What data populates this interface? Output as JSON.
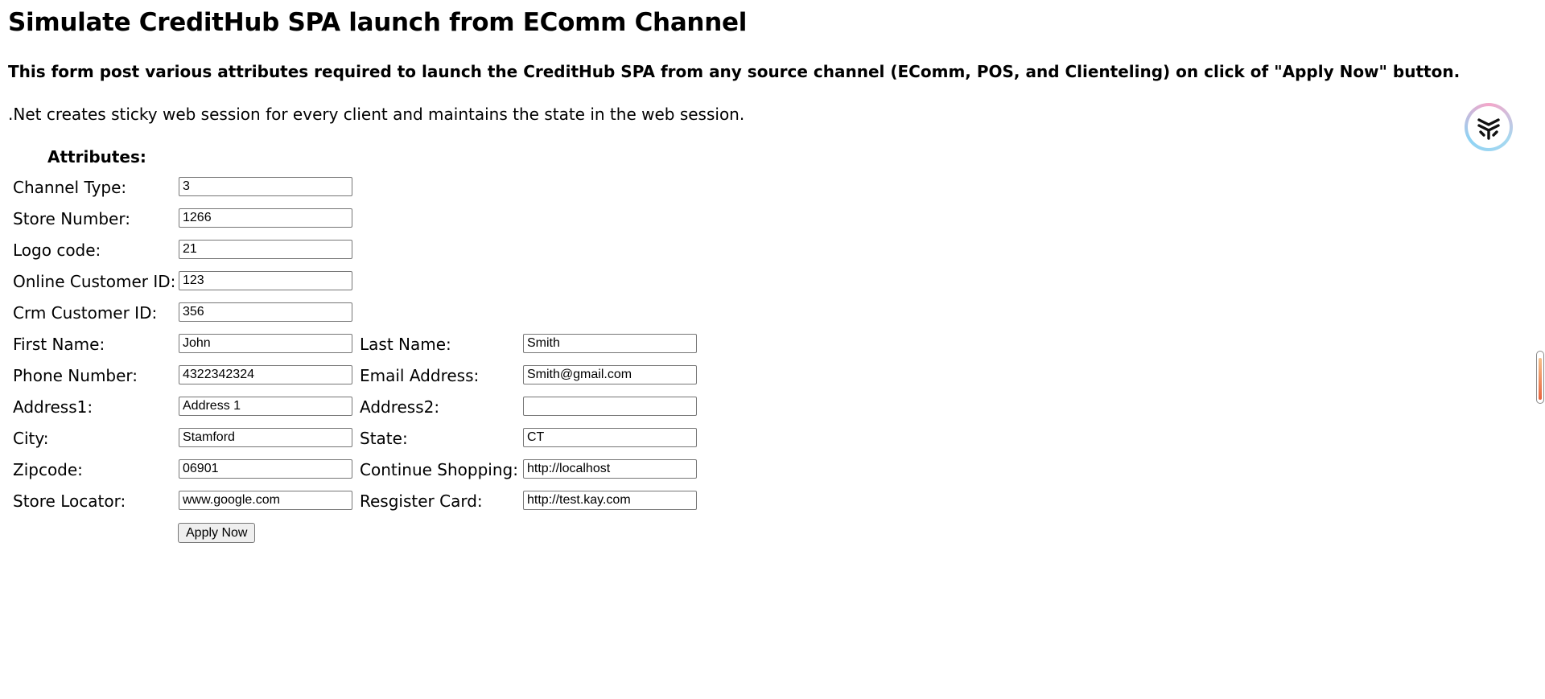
{
  "header": {
    "title": "Simulate CreditHub SPA launch from EComm Channel",
    "subtitle": "This form post various attributes required to launch the CreditHub SPA from any source channel (EComm, POS, and Clienteling) on click of \"Apply Now\" button.",
    "note": ".Net creates sticky web session for every client and maintains the state in the web session."
  },
  "form": {
    "heading": "Attributes:",
    "channel_type": {
      "label": "Channel Type:",
      "value": "3"
    },
    "store_number": {
      "label": "Store Number:",
      "value": "1266"
    },
    "logo_code": {
      "label": "Logo code:",
      "value": "21"
    },
    "online_customer_id": {
      "label": "Online Customer ID:",
      "value": "123"
    },
    "crm_customer_id": {
      "label": "Crm Customer ID:",
      "value": "356"
    },
    "first_name": {
      "label": "First Name:",
      "value": "John"
    },
    "last_name": {
      "label": "Last Name:",
      "value": "Smith"
    },
    "phone_number": {
      "label": "Phone Number:",
      "value": "4322342324"
    },
    "email_address": {
      "label": "Email Address:",
      "value": "Smith@gmail.com"
    },
    "address1": {
      "label": "Address1:",
      "value": "Address 1"
    },
    "address2": {
      "label": "Address2:",
      "value": ""
    },
    "city": {
      "label": "City:",
      "value": "Stamford"
    },
    "state": {
      "label": "State:",
      "value": "CT"
    },
    "zipcode": {
      "label": "Zipcode:",
      "value": "06901"
    },
    "continue_shopping": {
      "label": "Continue Shopping:",
      "value": "http://localhost"
    },
    "store_locator": {
      "label": "Store Locator:",
      "value": "www.google.com"
    },
    "register_card": {
      "label": "Resgister Card:",
      "value": "http://test.kay.com"
    },
    "submit_label": "Apply Now"
  },
  "overlay": {
    "extension_icon": "extension-logo-icon",
    "scroll_handle": "side-scroll-handle"
  }
}
